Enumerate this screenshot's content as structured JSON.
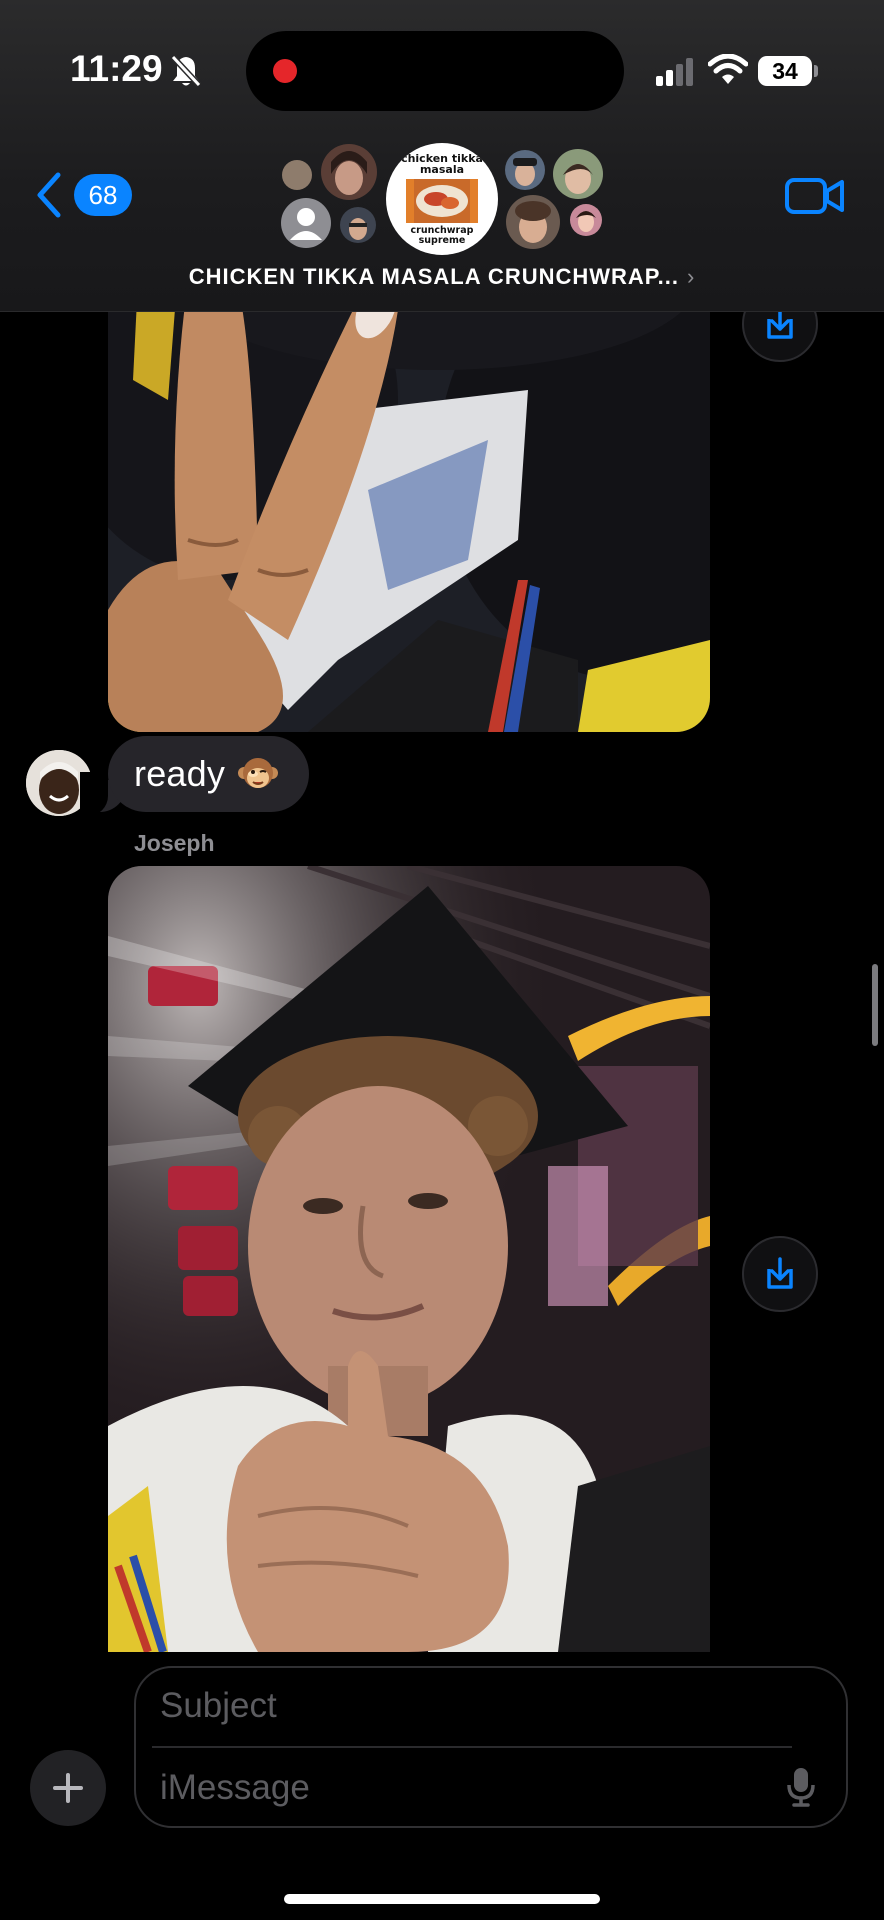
{
  "status_bar": {
    "time": "11:29",
    "battery": "34"
  },
  "header": {
    "back_count": "68",
    "group_name": "CHICKEN TIKKA MASALA CRUNCHWRAP...",
    "group_icon_top": "chicken tikka masala",
    "group_icon_bottom": "crunchwrap supreme"
  },
  "messages": {
    "text_1": "ready",
    "sender_2": "Joseph"
  },
  "composer": {
    "subject_placeholder": "Subject",
    "message_placeholder": "iMessage"
  },
  "colors": {
    "accent": "#0a84ff",
    "bubble": "#26252a",
    "recording": "#e5262a"
  },
  "icons": [
    "bell-slash-icon",
    "signal-icon",
    "wifi-icon",
    "back-chevron-icon",
    "video-camera-icon",
    "save-download-icon",
    "plus-icon",
    "microphone-icon",
    "monkey-emoji-icon"
  ]
}
